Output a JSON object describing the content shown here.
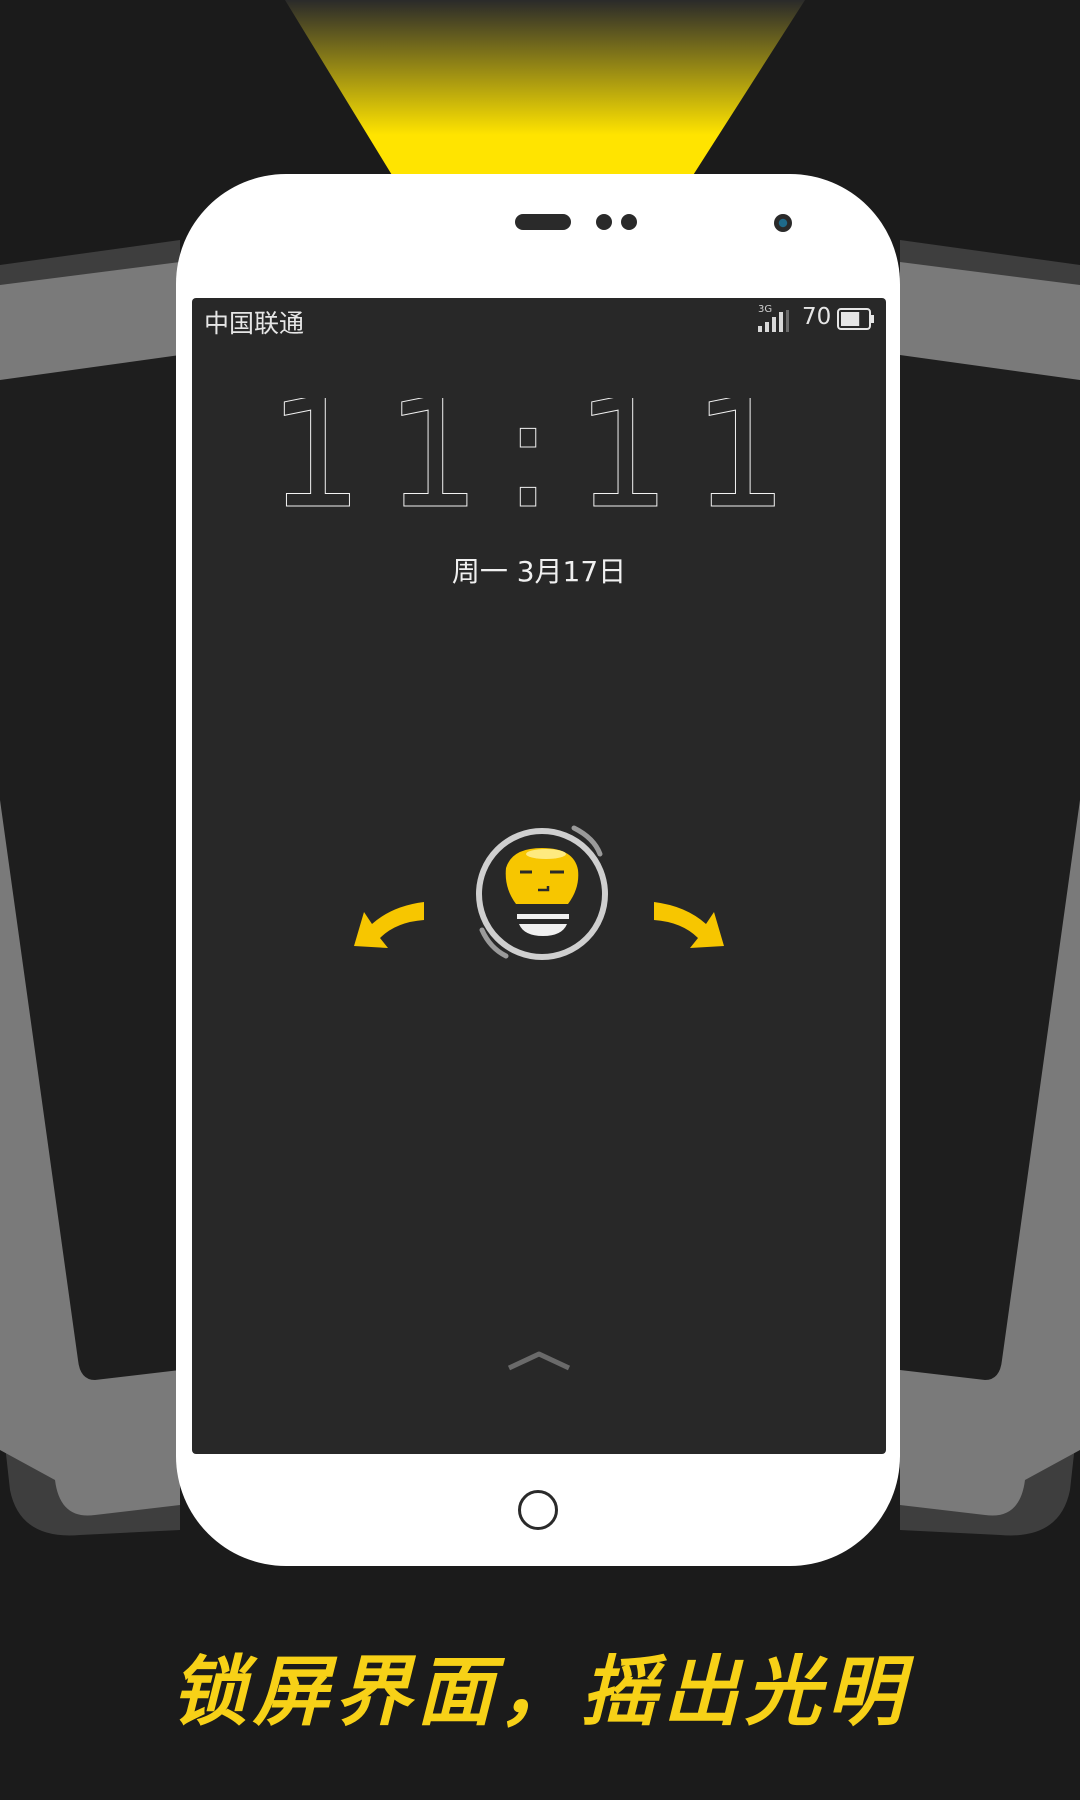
{
  "status_bar": {
    "carrier": "中国联通",
    "network_type": "3G",
    "battery_percent": "70",
    "battery_level": 0.7
  },
  "lock_screen": {
    "time": "11:11",
    "date": "周一  3月17日"
  },
  "icons": {
    "left_arrow": "curved-arrow-left-icon",
    "right_arrow": "curved-arrow-right-icon",
    "unlock_face": "face-bulb-icon",
    "swipe_up": "chevron-up-icon",
    "home": "home-button-icon"
  },
  "slogan": "锁屏界面，摇出光明",
  "colors": {
    "accent": "#f7d117",
    "background": "#1a1a1a",
    "screen": "#282828"
  }
}
